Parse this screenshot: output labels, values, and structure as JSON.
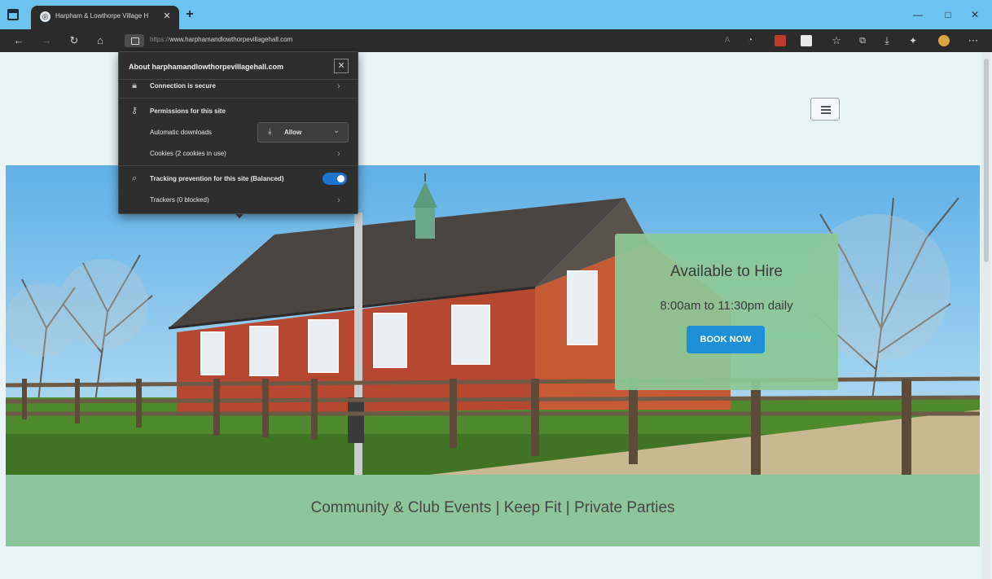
{
  "browser": {
    "tab_title": "Harpham & Lowthorpe Village H",
    "tab_favicon": "◎",
    "url_protocol": "https://",
    "url_host": "www.harphamandlowthorpevillagehall.com",
    "window_controls": {
      "minimize": "—",
      "maximize": "□",
      "close": "✕"
    },
    "nav": {
      "back": "←",
      "forward": "→",
      "refresh": "↻",
      "home": "⌂"
    },
    "toolbar_icons": [
      "read-aloud-icon",
      "extension-icon",
      "extension-red-icon",
      "extension-white-icon",
      "favorite-icon",
      "collections-icon",
      "downloads-icon",
      "extensions-puzzle-icon",
      "profile-avatar-icon",
      "more-menu-icon"
    ],
    "accent_color": "#1b75d0"
  },
  "site_info_popup": {
    "title": "About harphamandlowthorpevillagehall.com",
    "close": "✕",
    "connection": "Connection is secure",
    "permissions_heading": "Permissions for this site",
    "automatic_downloads_label": "Automatic downloads",
    "automatic_downloads_value": "Allow",
    "cookies": "Cookies (2 cookies in use)",
    "tracking": "Tracking prevention for this site (Balanced)",
    "tracking_enabled": true,
    "trackers": "Trackers (0 blocked)"
  },
  "site": {
    "hire_title": "Available to Hire",
    "hire_hours": "8:00am to 11:30pm daily",
    "book_now": "BOOK NOW",
    "tagline": "Community & Club Events | Keep Fit | Private Parties",
    "colors": {
      "band": "#8bc79a",
      "button": "#1c8fd6",
      "background": "#e8f4f8"
    }
  }
}
